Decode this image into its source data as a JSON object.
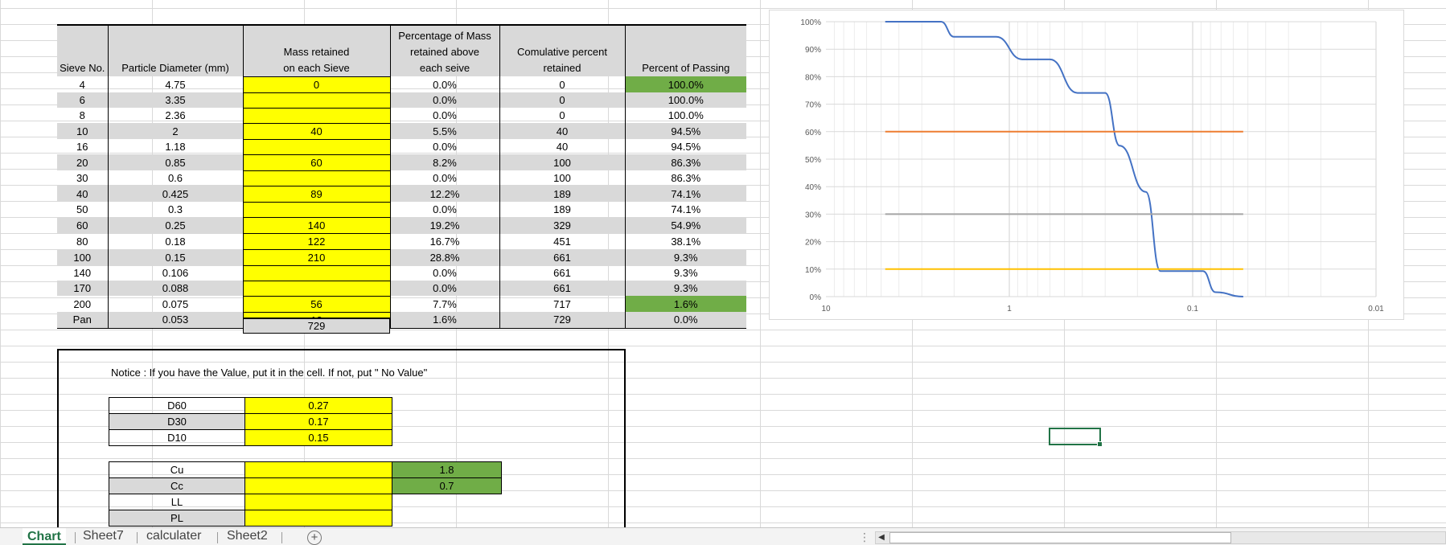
{
  "table": {
    "headers": {
      "sieve": "Sieve No.",
      "diameter": "Particle Diameter (mm)",
      "mass": [
        "Mass retained",
        "on each Sieve"
      ],
      "pct": [
        "Percentage of Mass",
        "retained above",
        "each seive"
      ],
      "cum": [
        "Comulative percent",
        "retained"
      ],
      "pass": "Percent of Passing"
    },
    "rows": [
      {
        "sieve": "4",
        "dia": "4.75",
        "mass": "0",
        "pct": "0.0%",
        "cum": "0",
        "pass": "100.0%"
      },
      {
        "sieve": "6",
        "dia": "3.35",
        "mass": "",
        "pct": "0.0%",
        "cum": "0",
        "pass": "100.0%"
      },
      {
        "sieve": "8",
        "dia": "2.36",
        "mass": "",
        "pct": "0.0%",
        "cum": "0",
        "pass": "100.0%"
      },
      {
        "sieve": "10",
        "dia": "2",
        "mass": "40",
        "pct": "5.5%",
        "cum": "40",
        "pass": "94.5%"
      },
      {
        "sieve": "16",
        "dia": "1.18",
        "mass": "",
        "pct": "0.0%",
        "cum": "40",
        "pass": "94.5%"
      },
      {
        "sieve": "20",
        "dia": "0.85",
        "mass": "60",
        "pct": "8.2%",
        "cum": "100",
        "pass": "86.3%"
      },
      {
        "sieve": "30",
        "dia": "0.6",
        "mass": "",
        "pct": "0.0%",
        "cum": "100",
        "pass": "86.3%"
      },
      {
        "sieve": "40",
        "dia": "0.425",
        "mass": "89",
        "pct": "12.2%",
        "cum": "189",
        "pass": "74.1%"
      },
      {
        "sieve": "50",
        "dia": "0.3",
        "mass": "",
        "pct": "0.0%",
        "cum": "189",
        "pass": "74.1%"
      },
      {
        "sieve": "60",
        "dia": "0.25",
        "mass": "140",
        "pct": "19.2%",
        "cum": "329",
        "pass": "54.9%"
      },
      {
        "sieve": "80",
        "dia": "0.18",
        "mass": "122",
        "pct": "16.7%",
        "cum": "451",
        "pass": "38.1%"
      },
      {
        "sieve": "100",
        "dia": "0.15",
        "mass": "210",
        "pct": "28.8%",
        "cum": "661",
        "pass": "9.3%"
      },
      {
        "sieve": "140",
        "dia": "0.106",
        "mass": "",
        "pct": "0.0%",
        "cum": "661",
        "pass": "9.3%"
      },
      {
        "sieve": "170",
        "dia": "0.088",
        "mass": "",
        "pct": "0.0%",
        "cum": "661",
        "pass": "9.3%"
      },
      {
        "sieve": "200",
        "dia": "0.075",
        "mass": "56",
        "pct": "7.7%",
        "cum": "717",
        "pass": "1.6%"
      },
      {
        "sieve": "Pan",
        "dia": "0.053",
        "mass": "12",
        "pct": "1.6%",
        "cum": "729",
        "pass": "0.0%"
      }
    ],
    "total_mass": "729"
  },
  "notice": {
    "text": "Notice : If you have the Value, put it in the cell. If not, put \" No Value\"",
    "d_values": [
      {
        "label": "D60",
        "value": "0.27"
      },
      {
        "label": "D30",
        "value": "0.17"
      },
      {
        "label": "D10",
        "value": "0.15"
      }
    ],
    "coefficients": [
      {
        "label": "Cu",
        "value": "",
        "result": "1.8"
      },
      {
        "label": "Cc",
        "value": "",
        "result": "0.7"
      },
      {
        "label": "LL",
        "value": ""
      },
      {
        "label": "PL",
        "value": ""
      }
    ]
  },
  "chart_data": {
    "type": "line",
    "x_scale": "log",
    "x_reversed": true,
    "xlim": [
      10,
      0.01
    ],
    "x_ticks": [
      "10",
      "1",
      "0.1",
      "0.01"
    ],
    "ylim": [
      0,
      100
    ],
    "y_ticks": [
      "0%",
      "10%",
      "20%",
      "30%",
      "40%",
      "50%",
      "60%",
      "70%",
      "80%",
      "90%",
      "100%"
    ],
    "grid": true,
    "colors": {
      "curve": "#4472c4",
      "d60": "#ed7d31",
      "d30": "#a5a5a5",
      "d10": "#ffc000"
    },
    "series": [
      {
        "x": [
          4.75,
          3.35,
          2.36,
          2,
          1.18,
          0.85,
          0.6,
          0.425,
          0.3,
          0.25,
          0.18,
          0.15,
          0.106,
          0.088,
          0.075,
          0.053
        ],
        "y": [
          100,
          100,
          100,
          94.5,
          94.5,
          86.3,
          86.3,
          74.1,
          74.1,
          54.9,
          38.1,
          9.3,
          9.3,
          9.3,
          1.6,
          0
        ]
      },
      {
        "x": [
          4.75,
          0.053
        ],
        "y": [
          60,
          60
        ]
      },
      {
        "x": [
          4.75,
          0.053
        ],
        "y": [
          30,
          30
        ]
      },
      {
        "x": [
          4.75,
          0.053
        ],
        "y": [
          10,
          10
        ]
      }
    ]
  },
  "tabs": [
    {
      "label": "Chart",
      "active": true
    },
    {
      "label": "Sheet7",
      "active": false
    },
    {
      "label": "calculater",
      "active": false
    },
    {
      "label": "Sheet2",
      "active": false
    }
  ],
  "add_sheet_glyph": "+",
  "scroll_dots_glyph": "⋮",
  "scroll_left_glyph": "◀"
}
